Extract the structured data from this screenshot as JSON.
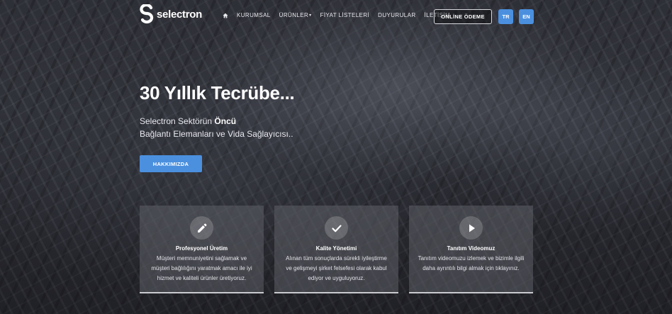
{
  "header": {
    "logo_text": "selectron",
    "nav": {
      "home_icon": "home-icon",
      "items": [
        "KURUMSAL",
        "ÜRÜNLER",
        "FİYAT LİSTELERİ",
        "DUYURULAR",
        "İLETİŞİM"
      ],
      "urunler_caret": "▾"
    },
    "payment_button": "ONLİNE ÖDEME",
    "languages": [
      "TR",
      "EN"
    ]
  },
  "hero": {
    "title": "30 Yıllık Tecrübe...",
    "line1_prefix": "Selectron Sektörün ",
    "line1_bold": "Öncü",
    "line2": "Bağlantı Elemanları ve Vida Sağlayıcısı..",
    "cta_button": "HAKKIMIZDA"
  },
  "cards": [
    {
      "icon": "pencil-icon",
      "title": "Profesyonel Üretim",
      "text": "Müşteri memnuniyetini sağlamak ve müşteri bağlılığını yaratmak amacı ile iyi hizmet ve kaliteli ürünler üretiyoruz."
    },
    {
      "icon": "checkmark-icon",
      "title": "Kalite Yönetimi",
      "text": "Alınan tüm sonuçlarda sürekli iyileştirme ve gelişmeyi şirket felsefesi olarak kabul ediyor ve uyguluyoruz."
    },
    {
      "icon": "play-icon",
      "title": "Tanıtım Videomuz",
      "text": "Tanıtım videomuzu izlemek ve bizimle ilgili daha ayrıntılı bilgi almak için tıklayınız."
    }
  ],
  "colors": {
    "accent": "#4b8fdf",
    "background": "#2b2c33"
  }
}
